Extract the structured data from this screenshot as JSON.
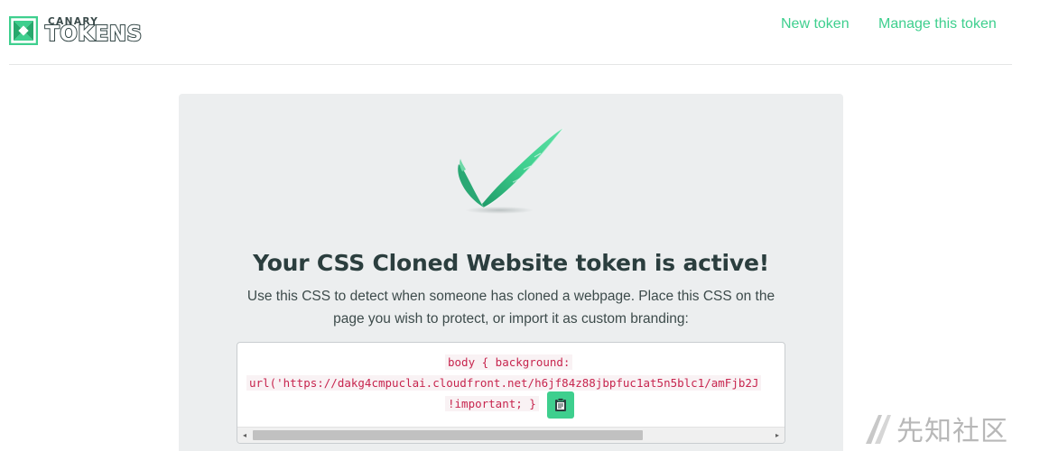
{
  "header": {
    "logo_small": "CANARY",
    "logo_big": "TOKENS",
    "nav": {
      "new_token": "New token",
      "manage_token": "Manage this token"
    }
  },
  "card": {
    "title": "Your CSS Cloned Website token is active!",
    "description": "Use this CSS to detect when someone has cloned a webpage. Place this CSS on the page you wish to protect, or import it as custom branding:",
    "code": {
      "line1": "body { background:",
      "line2": "url('https://dakg4cmpuclai.cloudfront.net/h6jf84z88jbpfuc1at5n5blc1/amFjb2J",
      "line3": "!important; }"
    },
    "copy_icon": "clipboard-icon",
    "check_icon": "feather-checkmark-icon"
  },
  "scrollbar": {
    "left_arrow": "◂",
    "right_arrow": "▸"
  },
  "watermark": {
    "text": "先知社区"
  },
  "colors": {
    "accent": "#3ecf8e",
    "card_bg": "#eceeef",
    "title": "#2b3e3e",
    "code_text": "#c7254e"
  }
}
